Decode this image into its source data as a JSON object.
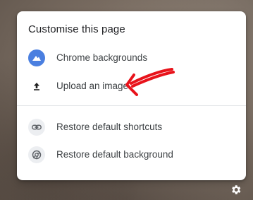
{
  "menu": {
    "title": "Customise this page",
    "items": [
      {
        "label": "Chrome backgrounds",
        "icon": "mountain-icon"
      },
      {
        "label": "Upload an image",
        "icon": "upload-icon"
      },
      {
        "label": "Restore default shortcuts",
        "icon": "link-icon"
      },
      {
        "label": "Restore default background",
        "icon": "chrome-icon"
      }
    ]
  },
  "annotation": {
    "color": "#e8131b",
    "icon": "red-arrow"
  },
  "settings": {
    "icon": "gear-icon"
  },
  "colors": {
    "backgrounds_icon_bg": "#4a7fe0",
    "grey_icon_bg": "#eceef1",
    "text": "#3c4043"
  }
}
